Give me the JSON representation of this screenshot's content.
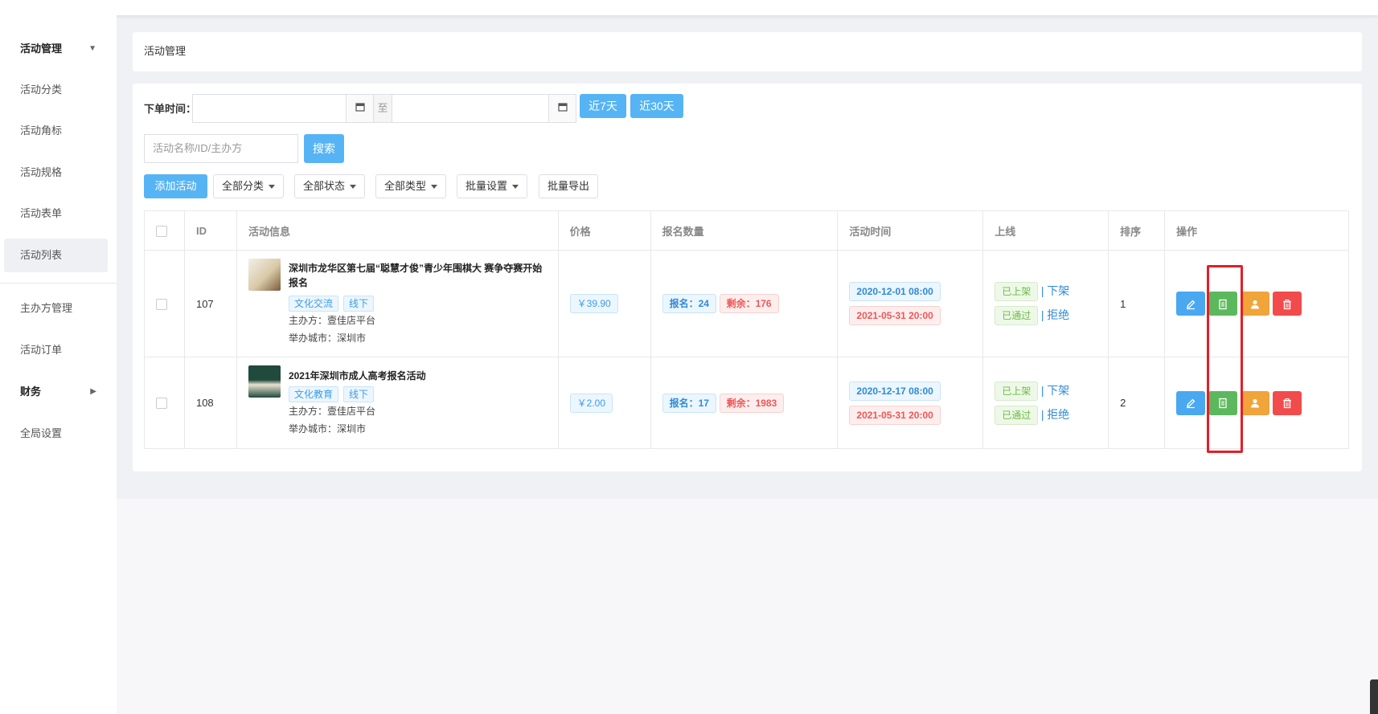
{
  "sidebar": {
    "items": [
      {
        "label": "活动管理",
        "group": true,
        "arrow": "▼"
      },
      {
        "label": "活动分类"
      },
      {
        "label": "活动角标"
      },
      {
        "label": "活动规格"
      },
      {
        "label": "活动表单"
      },
      {
        "label": "活动列表",
        "active": true
      },
      {
        "label": "主办方管理"
      },
      {
        "label": "活动订单"
      },
      {
        "label": "财务",
        "group": true,
        "arrow": "▶"
      },
      {
        "label": "全局设置"
      }
    ]
  },
  "breadcrumb": "活动管理",
  "filter": {
    "order_time_label": "下单时间：",
    "to_label": "至",
    "btn_7days": "近7天",
    "btn_30days": "近30天",
    "search_placeholder": "活动名称/ID/主办方",
    "search_btn": "搜索"
  },
  "toolbar": {
    "add": "添加活动",
    "category": "全部分类",
    "status": "全部状态",
    "type": "全部类型",
    "batch": "批量设置",
    "export": "批量导出"
  },
  "table": {
    "headers": [
      "ID",
      "活动信息",
      "价格",
      "报名数量",
      "活动时间",
      "上线",
      "排序",
      "操作"
    ],
    "rows": [
      {
        "id": "107",
        "title": "深圳市龙华区第七届“聪慧才俊”青少年围棋大 赛争夺赛开始报名",
        "tags": [
          "文化交流",
          "线下"
        ],
        "organizer": "主办方：壹佳店平台",
        "city": "举办城市：深圳市",
        "price": "￥39.90",
        "signup": "报名：24",
        "remain": "剩余：176",
        "start": "2020-12-01 08:00",
        "end": "2021-05-31 20:00",
        "status1": "已上架",
        "action1": "下架",
        "status2": "已通过",
        "action2": "拒绝",
        "sort": "1"
      },
      {
        "id": "108",
        "title": "2021年深圳市成人高考报名活动",
        "tags": [
          "文化教育",
          "线下"
        ],
        "organizer": "主办方：壹佳店平台",
        "city": "举办城市：深圳市",
        "price": "￥2.00",
        "signup": "报名：17",
        "remain": "剩余：1983",
        "start": "2020-12-17 08:00",
        "end": "2021-05-31 20:00",
        "status1": "已上架",
        "action1": "下架",
        "status2": "已通过",
        "action2": "拒绝",
        "sort": "2"
      }
    ]
  },
  "colors": {
    "primary": "#56b4f4",
    "edit": "#4aa8f0",
    "detail": "#5cb85c",
    "user": "#f0a43a",
    "delete": "#f24b4b",
    "highlight": "#e41e26"
  },
  "ops_icons": [
    "edit-icon",
    "document-icon",
    "user-icon",
    "trash-icon"
  ]
}
